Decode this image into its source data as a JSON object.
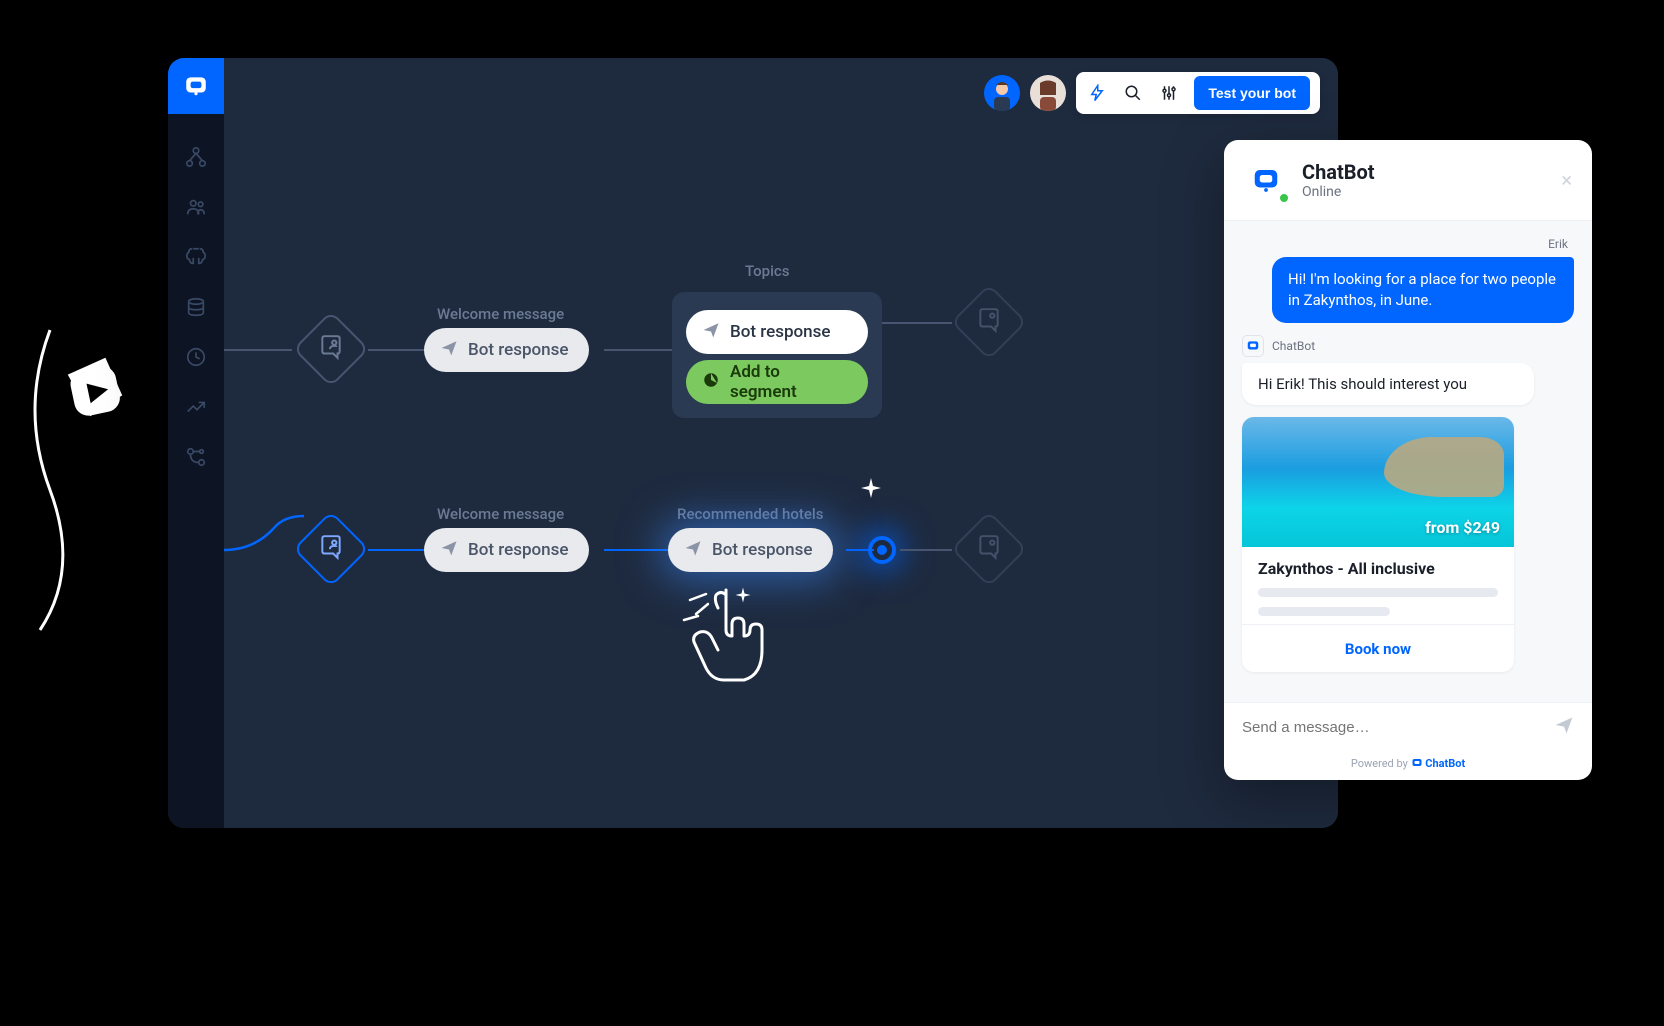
{
  "topbar": {
    "test_bot_label": "Test your bot"
  },
  "flow": {
    "row1": {
      "welcome_label": "Welcome message",
      "bot_response_label": "Bot response",
      "topics_label": "Topics",
      "topics_bot_response": "Bot response",
      "add_segment": "Add to segment"
    },
    "row2": {
      "welcome_label": "Welcome message",
      "bot_response_label": "Bot response",
      "rec_hotels_label": "Recommended hotels",
      "rec_hotels_bot_response": "Bot response"
    }
  },
  "chat": {
    "title": "ChatBot",
    "status": "Online",
    "user_name": "Erik",
    "user_message": "Hi! I'm looking for a place for two people in Zakynthos, in June.",
    "bot_name": "ChatBot",
    "bot_message": "Hi Erik! This should interest you",
    "card": {
      "price": "from $249",
      "title": "Zakynthos - All inclusive",
      "cta": "Book now"
    },
    "input_placeholder": "Send a message…",
    "powered_prefix": "Powered by ",
    "powered_brand": "ChatBot"
  }
}
